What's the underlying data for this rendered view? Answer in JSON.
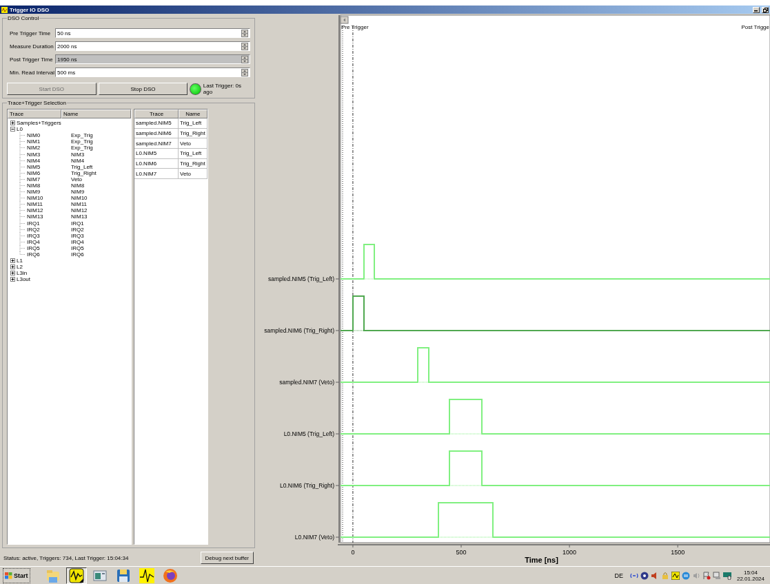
{
  "window": {
    "title": "Trigger IO DSO"
  },
  "dso_control": {
    "title": "DSO Control",
    "fields": [
      {
        "label": "Pre Trigger Time",
        "value": "50 ns",
        "disabled": false
      },
      {
        "label": "Measure Duration",
        "value": "2000 ns",
        "disabled": false
      },
      {
        "label": "Post Trigger Time",
        "value": "1950 ns",
        "disabled": true
      },
      {
        "label": "Min. Read Interval",
        "value": "500 ms",
        "disabled": false
      }
    ],
    "buttons": [
      {
        "label": "Start DSO",
        "disabled": true
      },
      {
        "label": "Stop DSO",
        "disabled": false
      }
    ],
    "indicator": {
      "on": true,
      "text": "Last Trigger: 0s ago"
    }
  },
  "selection": {
    "title": "Trace+Trigger Selection",
    "tree": {
      "columns": [
        "Trace",
        "Name"
      ],
      "items": [
        {
          "trace": "Samples+Triggers",
          "expanded": false
        },
        {
          "trace": "L0",
          "expanded": true,
          "children": [
            {
              "trace": "NIM0",
              "name": "Exp_Trig"
            },
            {
              "trace": "NIM1",
              "name": "Exp_Trig"
            },
            {
              "trace": "NIM2",
              "name": "Exp_Trig"
            },
            {
              "trace": "NIM3",
              "name": "NIM3"
            },
            {
              "trace": "NIM4",
              "name": "NIM4"
            },
            {
              "trace": "NIM5",
              "name": "Trig_Left"
            },
            {
              "trace": "NIM6",
              "name": "Trig_Right"
            },
            {
              "trace": "NIM7",
              "name": "Veto"
            },
            {
              "trace": "NIM8",
              "name": "NIM8"
            },
            {
              "trace": "NIM9",
              "name": "NIM9"
            },
            {
              "trace": "NIM10",
              "name": "NIM10"
            },
            {
              "trace": "NIM11",
              "name": "NIM11"
            },
            {
              "trace": "NIM12",
              "name": "NIM12"
            },
            {
              "trace": "NIM13",
              "name": "NIM13"
            },
            {
              "trace": "IRQ1",
              "name": "IRQ1"
            },
            {
              "trace": "IRQ2",
              "name": "IRQ2"
            },
            {
              "trace": "IRQ3",
              "name": "IRQ3"
            },
            {
              "trace": "IRQ4",
              "name": "IRQ4"
            },
            {
              "trace": "IRQ5",
              "name": "IRQ5"
            },
            {
              "trace": "IRQ6",
              "name": "IRQ6"
            }
          ]
        },
        {
          "trace": "L1",
          "expanded": false
        },
        {
          "trace": "L2",
          "expanded": false
        },
        {
          "trace": "L3in",
          "expanded": false
        },
        {
          "trace": "L3out",
          "expanded": false
        }
      ]
    },
    "table": {
      "columns": [
        "Trace",
        "Name"
      ],
      "rows": [
        {
          "trace": "sampled.NIM5",
          "name": "Trig_Left"
        },
        {
          "trace": "sampled.NIM6",
          "name": "Trig_Right"
        },
        {
          "trace": "sampled.NIM7",
          "name": "Veto"
        },
        {
          "trace": "L0.NIM5",
          "name": "Trig_Left"
        },
        {
          "trace": "L0.NIM6",
          "name": "Trig_Right"
        },
        {
          "trace": "L0.NIM7",
          "name": "Veto"
        }
      ]
    }
  },
  "status_bar": {
    "text": "Status: active, Triggers: 734, Last Trigger: 15:04:34",
    "button": "Debug next buffer"
  },
  "plot": {
    "markers": [
      "Pre Trigger",
      "Post Trigge"
    ],
    "traces": [
      {
        "label": "sampled.NIM5 (Trig_Left)",
        "color": "#80f080"
      },
      {
        "label": "sampled.NIM6 (Trig_Right)",
        "color": "#50a850"
      },
      {
        "label": "sampled.NIM7 (Veto)",
        "color": "#80f080"
      },
      {
        "label": "L0.NIM5 (Trig_Left)",
        "color": "#80f080"
      },
      {
        "label": "L0.NIM6 (Trig_Right)",
        "color": "#80f080"
      },
      {
        "label": "L0.NIM7 (Veto)",
        "color": "#80f080"
      }
    ],
    "x_ticks": [
      "0",
      "500",
      "1000",
      "1500"
    ],
    "x_label": "Time [ns]"
  },
  "taskbar": {
    "start": "Start",
    "apps": [
      {
        "kind": "folder",
        "selected": false
      },
      {
        "kind": "scope",
        "selected": true
      },
      {
        "kind": "window",
        "selected": false
      },
      {
        "kind": "floppy",
        "selected": false
      },
      {
        "kind": "wave",
        "selected": false
      },
      {
        "kind": "browser",
        "selected": false
      }
    ],
    "language": "DE",
    "time": "15:04",
    "date": "22.01.2024"
  }
}
